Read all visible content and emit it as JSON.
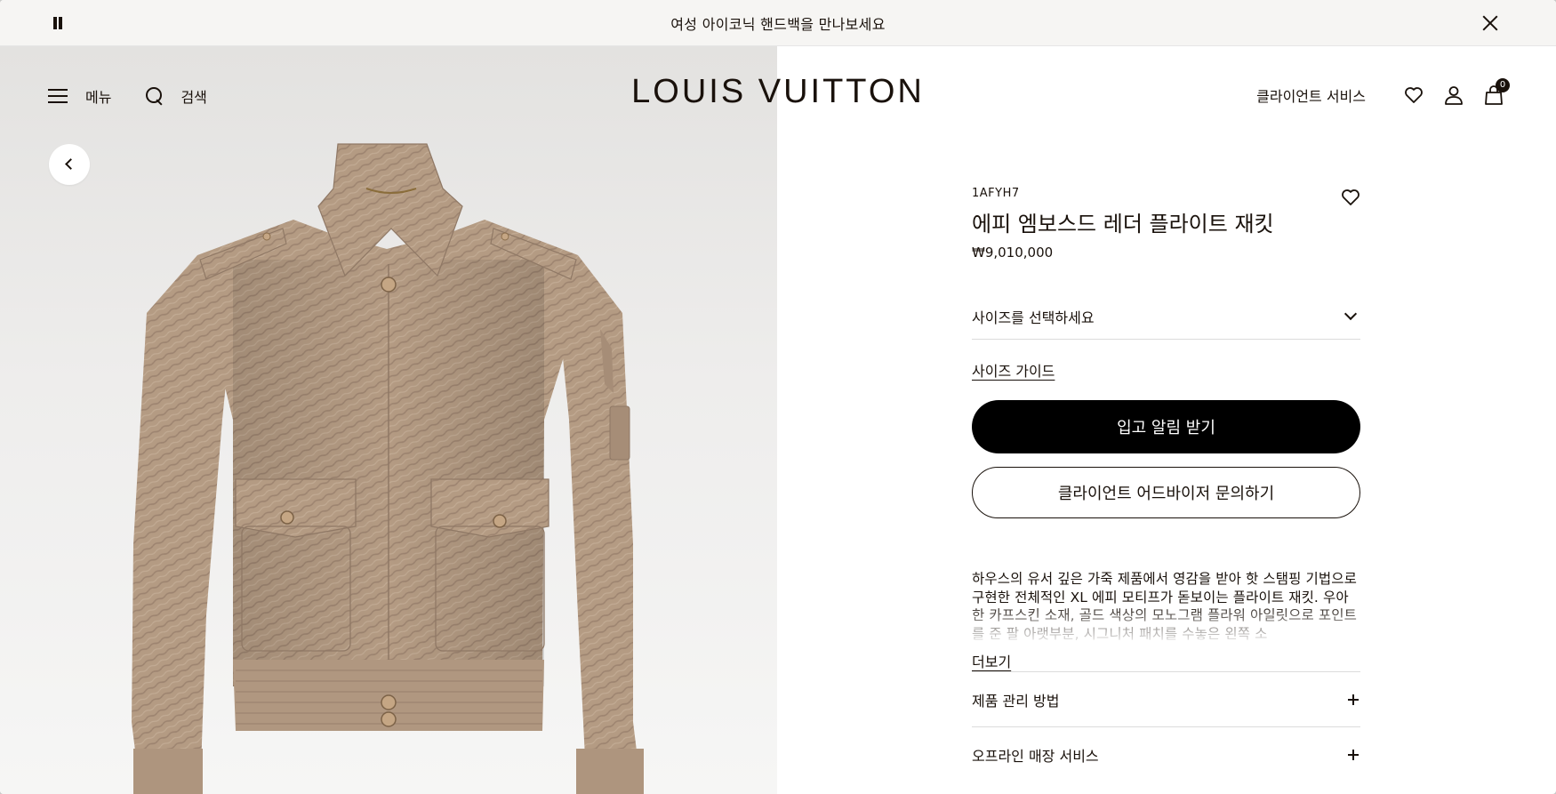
{
  "announcement": {
    "message": "여성 아이코닉 핸드백을 만나보세요"
  },
  "header": {
    "menu_label": "메뉴",
    "search_label": "검색",
    "logo": "LOUIS VUITTON",
    "client_services": "클라이언트 서비스",
    "cart_count": "0"
  },
  "product": {
    "sku": "1AFYH7",
    "title": "에피 엠보스드 레더 플라이트 재킷",
    "price": "₩9,010,000",
    "size_select_label": "사이즈를 선택하세요",
    "size_guide": "사이즈 가이드",
    "primary_cta": "입고 알림 받기",
    "secondary_cta": "클라이언트 어드바이저 문의하기",
    "description": "하우스의 유서 깊은 가죽 제품에서 영감을 받아 핫 스탬핑 기법으로 구현한 전체적인 XL 에피 모티프가 돋보이는 플라이트 재킷. 우아한 카프스킨 소재, 골드 색상의 모노그램 플라워 아일릿으로 포인트를 준 팔 아랫부분, 시그니처 패치를 수놓은 왼쪽 소",
    "more": "더보기",
    "accordions": [
      {
        "label": "제품 관리 방법"
      },
      {
        "label": "오프라인 매장 서비스"
      }
    ]
  },
  "colors": {
    "ink": "#19110b",
    "jacket": "#b39a82"
  },
  "icons": [
    "pause-icon",
    "close-icon",
    "hamburger-icon",
    "search-icon",
    "heart-icon",
    "account-icon",
    "bag-icon",
    "chevron-left-icon",
    "chevron-down-icon",
    "plus-icon"
  ]
}
